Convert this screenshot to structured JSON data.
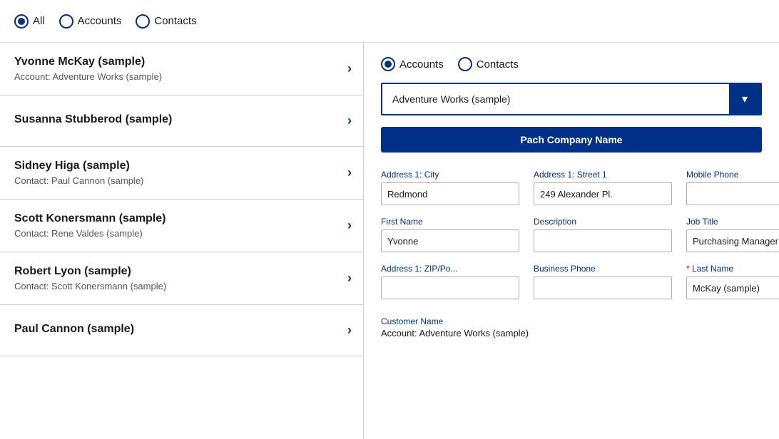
{
  "topBar": {
    "radioGroup": [
      {
        "id": "all",
        "label": "All",
        "checked": true
      },
      {
        "id": "accounts",
        "label": "Accounts",
        "checked": false
      },
      {
        "id": "contacts",
        "label": "Contacts",
        "checked": false
      }
    ]
  },
  "leftPanel": {
    "contacts": [
      {
        "name": "Yvonne McKay (sample)",
        "sub": "Account: Adventure Works (sample)"
      },
      {
        "name": "Susanna Stubberod (sample)",
        "sub": ""
      },
      {
        "name": "Sidney Higa (sample)",
        "sub": "Contact: Paul Cannon (sample)"
      },
      {
        "name": "Scott Konersmann (sample)",
        "sub": "Contact: Rene Valdes (sample)"
      },
      {
        "name": "Robert Lyon (sample)",
        "sub": "Contact: Scott Konersmann (sample)"
      },
      {
        "name": "Paul Cannon (sample)",
        "sub": ""
      }
    ]
  },
  "rightPanel": {
    "radioGroup": [
      {
        "id": "r-accounts",
        "label": "Accounts",
        "checked": true
      },
      {
        "id": "r-contacts",
        "label": "Contacts",
        "checked": false
      }
    ],
    "dropdown": {
      "value": "Adventure Works (sample)",
      "dropdownIcon": "▾"
    },
    "patchButton": "Pach Company Name",
    "fields": [
      {
        "id": "city",
        "label": "Address 1: City",
        "value": "Redmond",
        "required": false
      },
      {
        "id": "street",
        "label": "Address 1: Street 1",
        "value": "249 Alexander Pl.",
        "required": false
      },
      {
        "id": "mobile",
        "label": "Mobile Phone",
        "value": "",
        "required": false
      },
      {
        "id": "firstname",
        "label": "First Name",
        "value": "Yvonne",
        "required": false
      },
      {
        "id": "description",
        "label": "Description",
        "value": "",
        "required": false
      },
      {
        "id": "jobtitle",
        "label": "Job Title",
        "value": "Purchasing Manager",
        "required": false
      },
      {
        "id": "zip",
        "label": "Address 1: ZIP/Po...",
        "value": "",
        "required": false
      },
      {
        "id": "bizphone",
        "label": "Business Phone",
        "value": "",
        "required": false
      },
      {
        "id": "lastname",
        "label": "Last Name",
        "value": "McKay (sample)",
        "required": true
      }
    ],
    "customerName": {
      "label": "Customer Name",
      "value": "Account: Adventure Works (sample)"
    }
  }
}
